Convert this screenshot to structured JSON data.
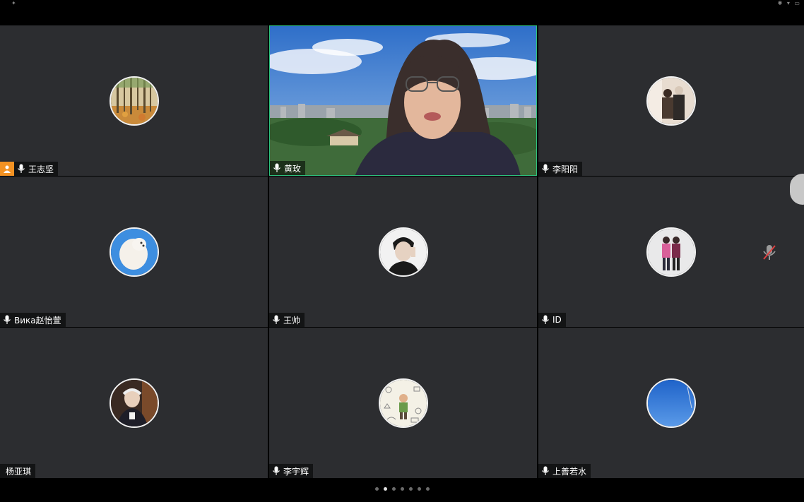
{
  "participants": [
    {
      "name": "王志坚",
      "host": true,
      "mic": "on",
      "avatar": "forest-avatar"
    },
    {
      "name": "黄玫",
      "host": false,
      "mic": "on",
      "video": true
    },
    {
      "name": "李阳阳",
      "host": false,
      "mic": "on",
      "avatar": "couple-avatar"
    },
    {
      "name": "Вика赵怡萱",
      "host": false,
      "mic": "on",
      "avatar": "dog-avatar"
    },
    {
      "name": "王帅",
      "host": false,
      "mic": "on",
      "avatar": "portrait-avatar"
    },
    {
      "name": "ID",
      "host": false,
      "mic": "on",
      "avatar": "walking-avatar",
      "muted_indicator": true
    },
    {
      "name": "杨亚琪",
      "host": false,
      "mic": "none",
      "avatar": "elder-avatar"
    },
    {
      "name": "李宇辉",
      "host": false,
      "mic": "on",
      "avatar": "doodle-avatar"
    },
    {
      "name": "上善若水",
      "host": false,
      "mic": "on",
      "avatar": "sky-avatar"
    }
  ],
  "pager": {
    "count": 7,
    "active_index": 1
  },
  "colors": {
    "tile_bg": "#2c2d30",
    "active_border": "#2ec27e",
    "host_badge": "#f39223"
  }
}
